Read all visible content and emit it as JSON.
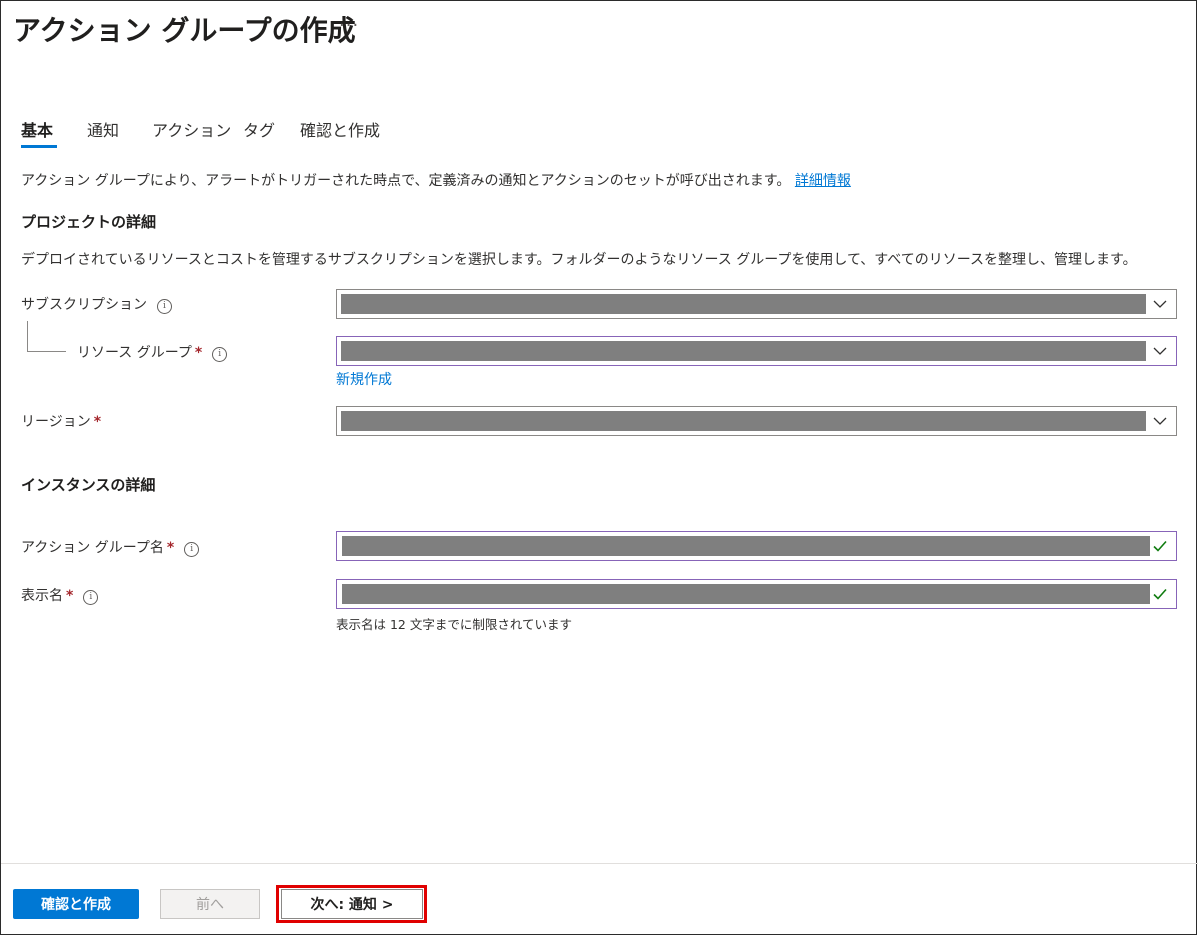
{
  "header": {
    "title": "アクション グループの作成",
    "more_label": "···"
  },
  "tabs": [
    {
      "label": "基本",
      "active": true
    },
    {
      "label": "通知",
      "active": false
    },
    {
      "label": "アクション",
      "active": false
    },
    {
      "label": "タグ",
      "active": false
    },
    {
      "label": "確認と作成",
      "active": false
    }
  ],
  "intro": {
    "text": "アクション グループにより、アラートがトリガーされた時点で、定義済みの通知とアクションのセットが呼び出されます。",
    "link": "詳細情報"
  },
  "project": {
    "heading": "プロジェクトの詳細",
    "description": "デプロイされているリソースとコストを管理するサブスクリプションを選択します。フォルダーのようなリソース グループを使用して、すべてのリソースを整理し、管理します。",
    "subscription_label": "サブスクリプション",
    "resource_group_label": "リソース グループ",
    "create_new_link": "新規作成",
    "region_label": "リージョン"
  },
  "instance": {
    "heading": "インスタンスの詳細",
    "action_group_name_label": "アクション グループ名",
    "display_name_label": "表示名",
    "display_name_hint": "表示名は 12 文字までに制限されています"
  },
  "required_mark": "*",
  "info_glyph": "i",
  "footer": {
    "review_create_button": "確認と作成",
    "previous_button": "前へ",
    "next_button": "次へ: 通知 >"
  },
  "colors": {
    "accent": "#0078d4",
    "focus_border": "#8764b8",
    "required": "#a4262c",
    "valid_check": "#107c10",
    "highlight_box": "#e00000",
    "redaction": "#7f7f7f"
  },
  "icons": [
    "chevron-down-icon",
    "checkmark-icon",
    "info-icon"
  ]
}
